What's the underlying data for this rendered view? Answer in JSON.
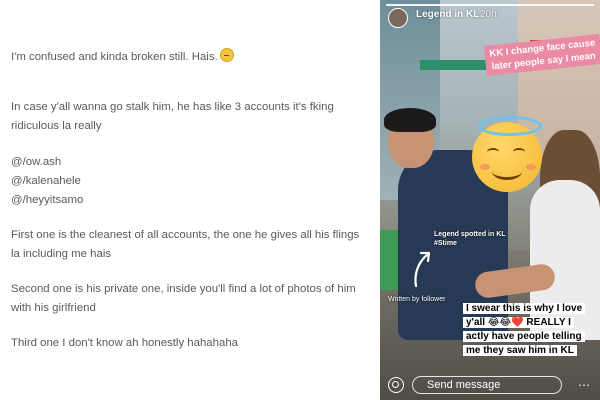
{
  "blog": {
    "paragraphs": [
      "I'm confused and kinda broken still. Hais.",
      "In case y'all wanna go stalk him, he has like 3 accounts it's fking ridiculous la really",
      "@/ow.ash",
      "@/kalenahele",
      "@/heyyitsamo",
      "First one is the cleanest of all accounts, the one he gives all his flings la including me hais",
      "Second one is his private one, inside you'll find a lot of photos of him with his girlfriend",
      "Third one I don't know ah honestly hahahaha"
    ]
  },
  "story": {
    "account": "Legend in KL",
    "time": "20h",
    "pink_caption": "KK I change face cause later people say I mean",
    "spotted_line1": "Legend spotted in KL",
    "spotted_line2": "#Stime",
    "written_by": "Written by follower",
    "white_caption": "I swear this is why I love y'all 😂😂❤️ REALLY I actly have people telling me they saw him in KL",
    "send_placeholder": "Send message",
    "icons": [
      "avatar",
      "halo-smile-emoji-sticker",
      "arrow-icon",
      "camera-icon",
      "more-icon"
    ]
  }
}
